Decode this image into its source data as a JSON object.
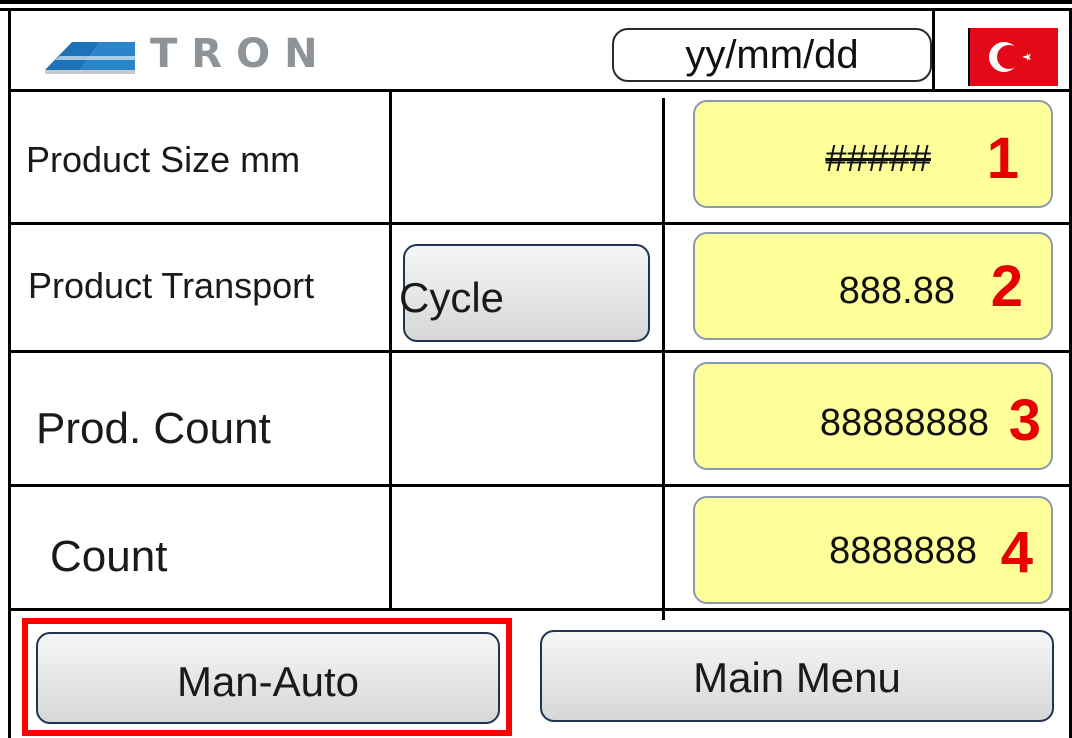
{
  "header": {
    "logo_text": "TRON",
    "date_placeholder": "yy/mm/dd",
    "flag_icon": "turkish-flag-icon"
  },
  "rows": [
    {
      "label": "Product Size mm",
      "value": "#####",
      "marker": "1"
    },
    {
      "label": "Product Transport",
      "button": "Cycle",
      "value": "888.88",
      "marker": "2"
    },
    {
      "label": "Prod.  Count",
      "value": "88888888",
      "marker": "3"
    },
    {
      "label": "Count",
      "value": "8888888",
      "marker": "4"
    }
  ],
  "footer": {
    "man_auto_label": "Man-Auto",
    "main_menu_label": "Main Menu"
  },
  "colors": {
    "value_bg": "#ffff99",
    "marker": "#e60000",
    "highlight_border": "#ff0000",
    "flag": "#e30a17"
  }
}
